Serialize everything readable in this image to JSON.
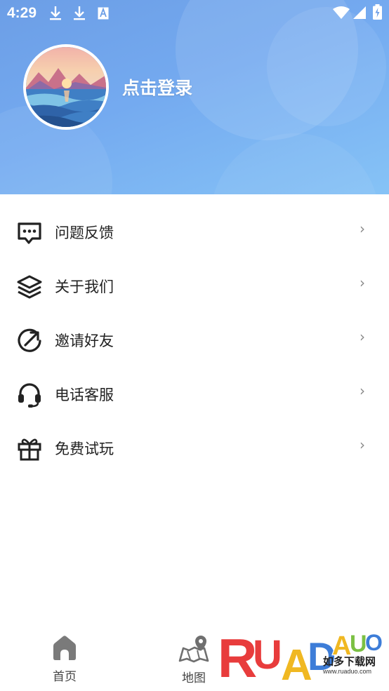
{
  "status_bar": {
    "time": "4:29",
    "left_icons": [
      "download-icon",
      "download-icon",
      "text-a-icon"
    ],
    "right_icons": [
      "wifi-icon",
      "signal-icon",
      "battery-charging-icon"
    ]
  },
  "header": {
    "login_text": "点击登录",
    "gradient_colors": [
      "#6c9ee6",
      "#86c3f6"
    ]
  },
  "menu": {
    "items": [
      {
        "label": "问题反馈",
        "icon": "feedback-chat-icon",
        "chevron": "›"
      },
      {
        "label": "关于我们",
        "icon": "layers-icon",
        "chevron": "›"
      },
      {
        "label": "邀请好友",
        "icon": "invite-arrow-icon",
        "chevron": "›"
      },
      {
        "label": "电话客服",
        "icon": "headset-icon",
        "chevron": "›"
      },
      {
        "label": "免费试玩",
        "icon": "gift-icon",
        "chevron": "›"
      }
    ]
  },
  "tabbar": {
    "tabs": [
      {
        "label": "首页",
        "icon": "home-icon"
      },
      {
        "label": "地图",
        "icon": "map-pin-icon"
      }
    ]
  },
  "watermark": {
    "logo_text": "RUADAUO",
    "cn_text": "如多下载网",
    "url": "www.ruaduo.com"
  }
}
